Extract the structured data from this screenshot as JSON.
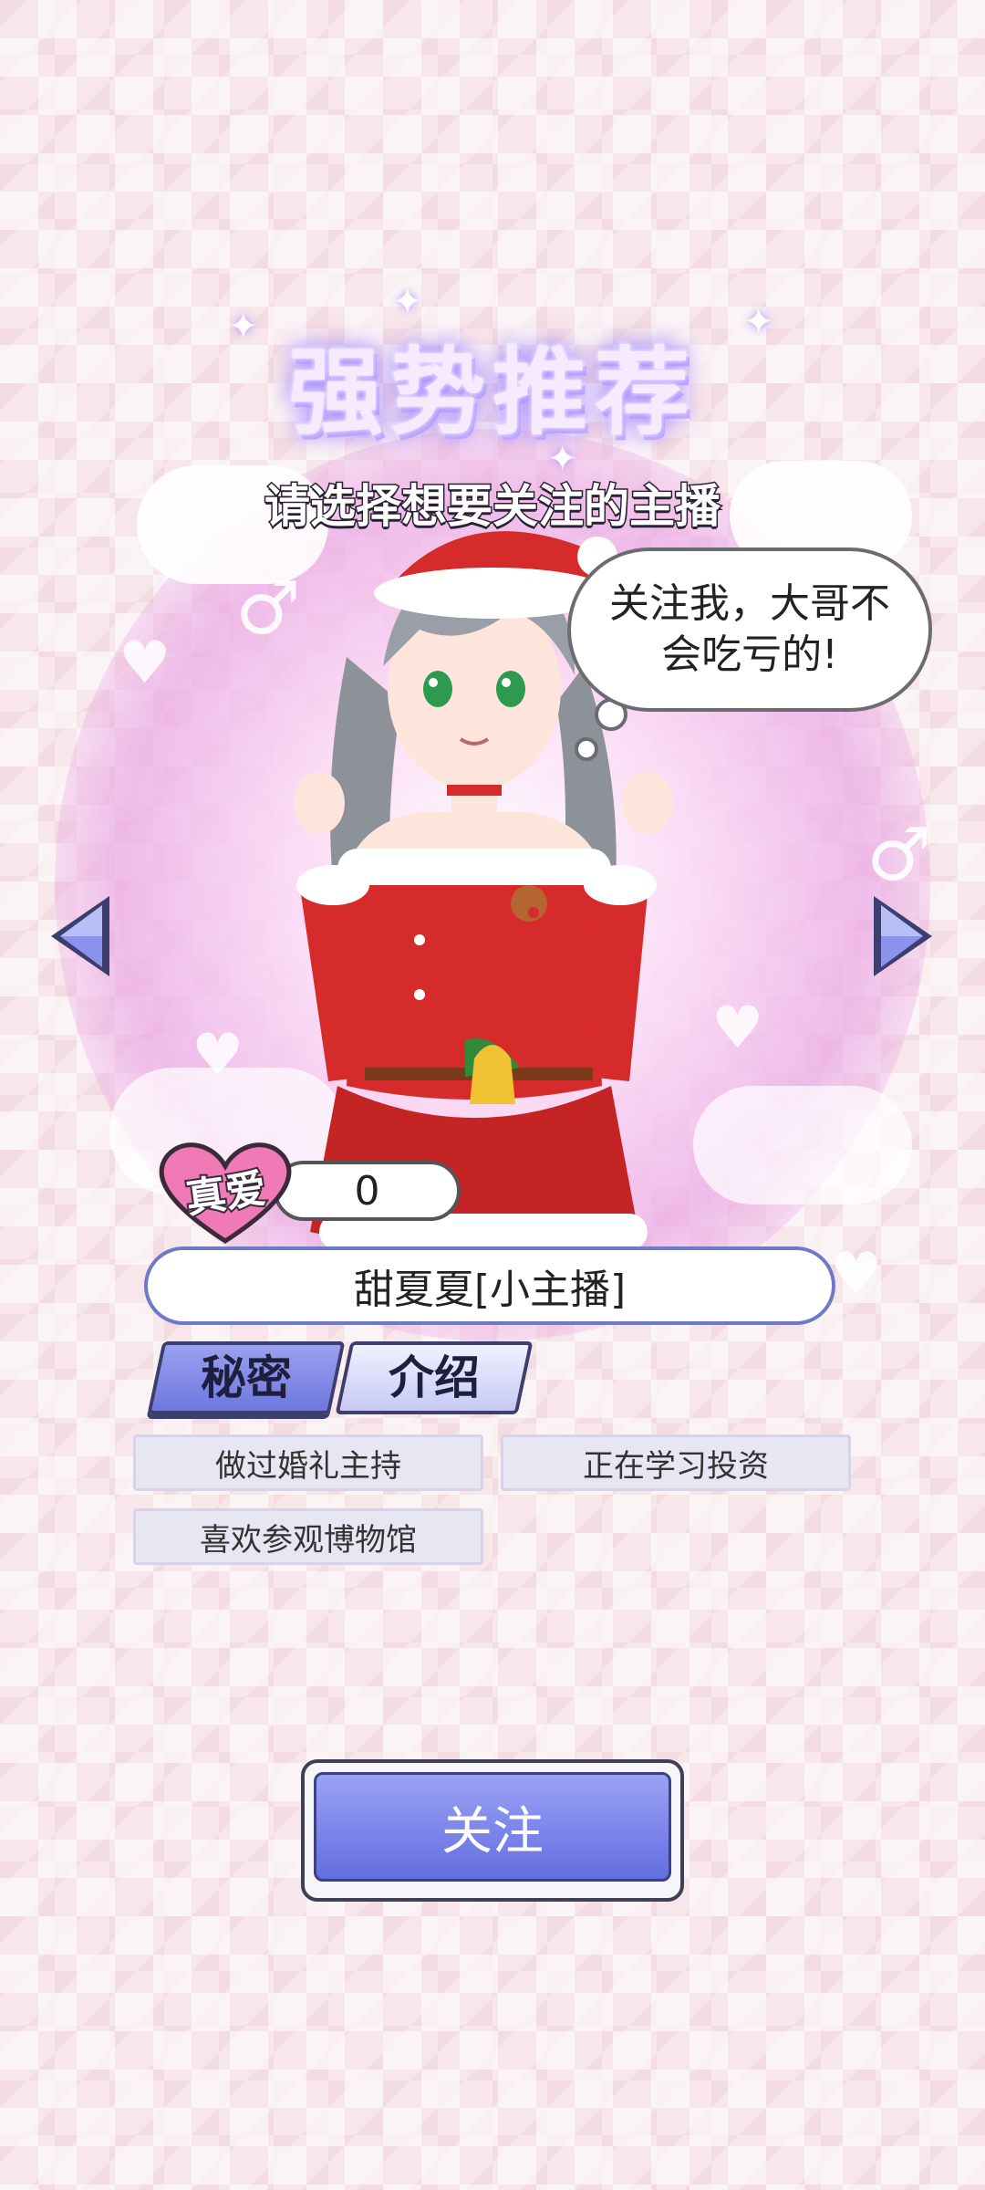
{
  "header": {
    "title": "强势推荐",
    "subtitle": "请选择想要关注的主播"
  },
  "speech_bubble": {
    "line1": "关注我，大哥不",
    "line2": "会吃亏的!"
  },
  "navigation": {
    "prev_icon": "triangle-left-icon",
    "next_icon": "triangle-right-icon"
  },
  "true_love": {
    "label": "真爱",
    "value": "0"
  },
  "streamer": {
    "name": "甜夏夏[小主播]"
  },
  "tabs": [
    {
      "label": "秘密",
      "active": true
    },
    {
      "label": "介绍",
      "active": false
    }
  ],
  "traits": [
    "做过婚礼主持",
    "正在学习投资",
    "喜欢参观博物馆"
  ],
  "follow_button": {
    "label": "关注"
  },
  "colors": {
    "accent": "#6e77de",
    "heart_pink": "#f07ab5",
    "outfit_red": "#d62b2b"
  }
}
